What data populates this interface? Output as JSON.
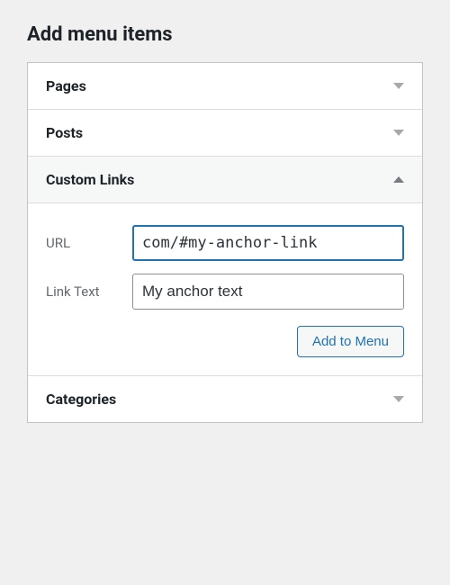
{
  "heading": "Add menu items",
  "sections": {
    "pages": {
      "title": "Pages",
      "expanded": false
    },
    "posts": {
      "title": "Posts",
      "expanded": false
    },
    "custom": {
      "title": "Custom Links",
      "expanded": true
    },
    "categories": {
      "title": "Categories",
      "expanded": false
    }
  },
  "custom_links_form": {
    "url_label": "URL",
    "url_value": "com/#my-anchor-link",
    "linktext_label": "Link Text",
    "linktext_value": "My anchor text",
    "submit_label": "Add to Menu"
  }
}
